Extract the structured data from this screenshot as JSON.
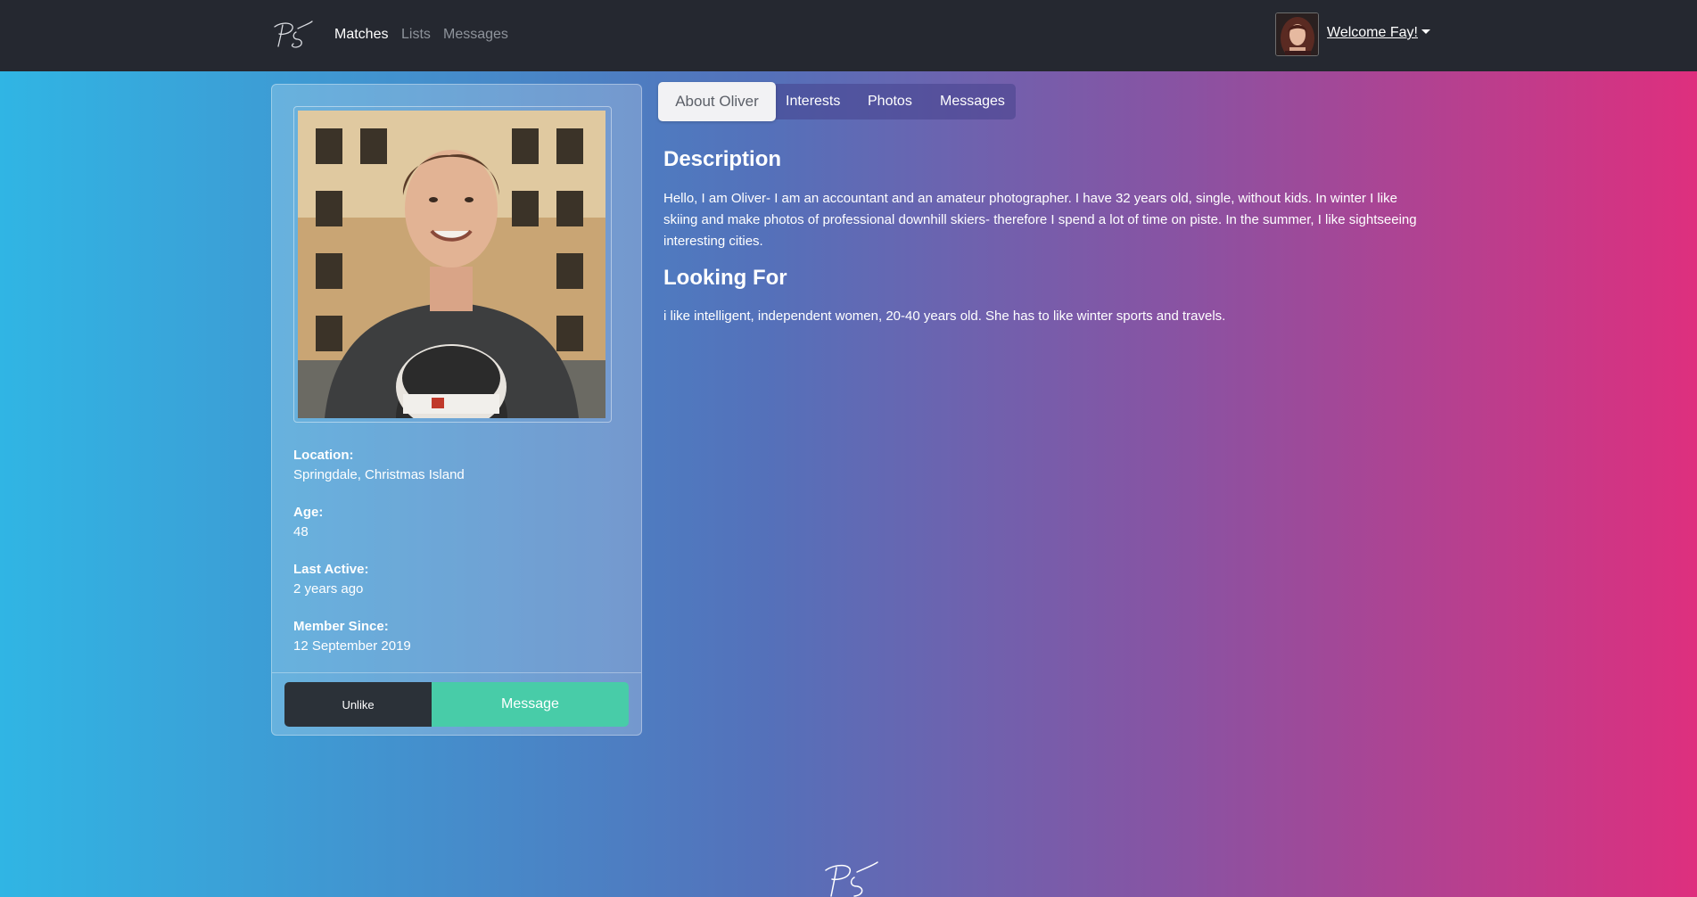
{
  "nav": {
    "links": [
      {
        "label": "Matches",
        "active": true
      },
      {
        "label": "Lists",
        "active": false
      },
      {
        "label": "Messages",
        "active": false
      }
    ],
    "welcome": "Welcome Fay!"
  },
  "profile": {
    "fields": [
      {
        "label": "Location:",
        "value": "Springdale, Christmas Island"
      },
      {
        "label": "Age:",
        "value": "48"
      },
      {
        "label": "Last Active:",
        "value": "2 years ago"
      },
      {
        "label": "Member Since:",
        "value": "12 September 2019"
      }
    ],
    "buttons": {
      "unlike": "Unlike",
      "message": "Message"
    }
  },
  "tabs": [
    {
      "label": "About Oliver",
      "active": true
    },
    {
      "label": "Interests",
      "active": false
    },
    {
      "label": "Photos",
      "active": false
    },
    {
      "label": "Messages",
      "active": false
    }
  ],
  "about": {
    "description_heading": "Description",
    "description_text": "Hello, I am Oliver- I am an accountant and an amateur photographer. I have 32 years old, single, without kids. In winter I like skiing and make photos of professional downhill skiers- therefore I spend a lot of time on piste. In the summer, I like sightseeing interesting cities.",
    "looking_for_heading": "Looking For",
    "looking_for_text": "i like intelligent, independent women, 20-40 years old. She has to like winter sports and travels."
  },
  "colors": {
    "navbar": "#252830",
    "gradient_start": "#30b5e4",
    "gradient_end": "#de2f7e",
    "message_button": "#48cca8",
    "unlike_button": "#2b3138"
  },
  "icons": {
    "brand_logo": "ps-signature-logo",
    "user_avatar": "user-avatar-photo",
    "profile_photo": "profile-photo"
  }
}
